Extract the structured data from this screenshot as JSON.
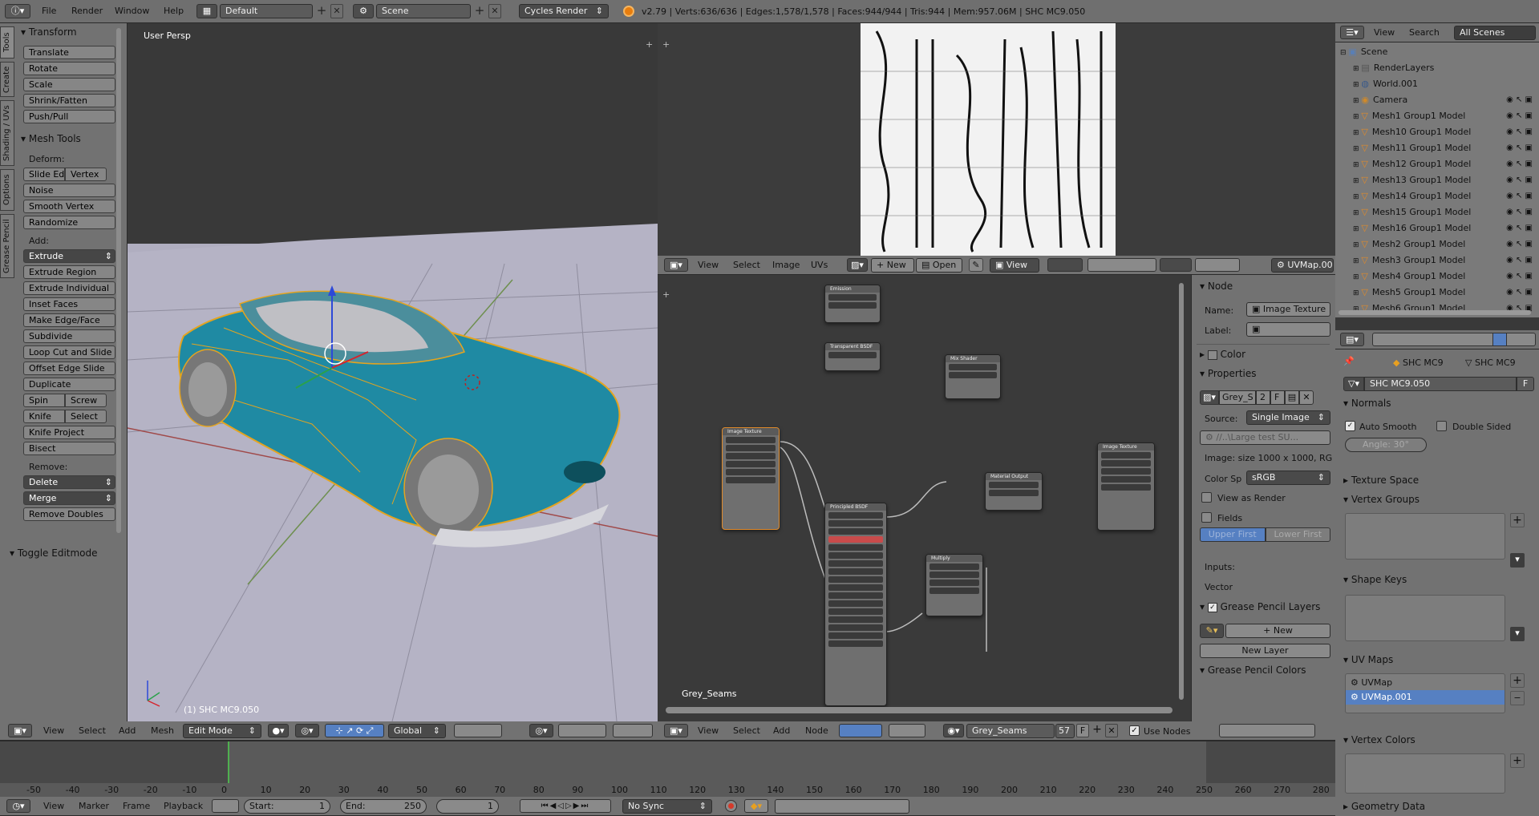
{
  "topbar": {
    "menus": [
      "File",
      "Render",
      "Window",
      "Help"
    ],
    "layout": "Default",
    "scene": "Scene",
    "engine": "Cycles Render",
    "stats": "v2.79 | Verts:636/636 | Edges:1,578/1,578 | Faces:944/944 | Tris:944 | Mem:957.06M | SHC MC9.050"
  },
  "toolshelf": {
    "tabs": [
      "Tools",
      "Create",
      "Shading / UVs",
      "Options",
      "Grease Pencil"
    ],
    "transform_title": "Transform",
    "transform": [
      "Translate",
      "Rotate",
      "Scale",
      "Shrink/Fatten",
      "Push/Pull"
    ],
    "mesh_tools_title": "Mesh Tools",
    "deform_label": "Deform:",
    "deform_pair": [
      "Slide Ed",
      "Vertex"
    ],
    "deform": [
      "Noise",
      "Smooth Vertex",
      "Randomize"
    ],
    "add_label": "Add:",
    "extrude": "Extrude",
    "add": [
      "Extrude Region",
      "Extrude Individual",
      "Inset Faces",
      "Make Edge/Face",
      "Subdivide",
      "Loop Cut and Slide",
      "Offset Edge Slide",
      "Duplicate"
    ],
    "spin_pair": [
      "Spin",
      "Screw"
    ],
    "knife_pair": [
      "Knife",
      "Select"
    ],
    "add2": [
      "Knife Project",
      "Bisect"
    ],
    "remove_label": "Remove:",
    "delete": "Delete",
    "merge": "Merge",
    "remove_doubles": "Remove Doubles",
    "toggle_editmode": "Toggle Editmode"
  },
  "viewport": {
    "view_name": "User Persp",
    "object_label": "(1) SHC MC9.050",
    "header": {
      "view": "View",
      "select": "Select",
      "add": "Add",
      "mesh": "Mesh",
      "mode": "Edit Mode",
      "orientation": "Global"
    }
  },
  "image_editor": {
    "header": {
      "view": "View",
      "select": "Select",
      "image": "Image",
      "uvs": "UVs",
      "new": "New",
      "open": "Open",
      "view2": "View",
      "uvmap": "UVMap.001"
    }
  },
  "node_editor": {
    "material_label": "Grey_Seams",
    "header": {
      "view": "View",
      "select": "Select",
      "add": "Add",
      "node": "Node",
      "material": "Grey_Seams",
      "users": "57",
      "fake": "F",
      "use_nodes": "Use Nodes"
    },
    "nodes": {
      "emission": "Emission",
      "transparent": "Transparent BSDF",
      "mix": "Mix Shader",
      "image_tex": "Image Texture",
      "principled": "Principled BSDF",
      "output": "Material Output",
      "math": "Multiply",
      "image_tex2": "Image Texture"
    }
  },
  "node_sidebar": {
    "node_section": "Node",
    "name_label": "Name:",
    "name_value": "Image Texture",
    "label_label": "Label:",
    "color_section": "Color",
    "properties_section": "Properties",
    "image_name": "Grey_S",
    "image_users": "2",
    "image_fake": "F",
    "source_label": "Source:",
    "source_value": "Single Image",
    "filepath": "//..\\Large test SU...",
    "image_info": "Image: size 1000 x 1000, RG",
    "colorspace_label": "Color Sp",
    "colorspace_value": "sRGB",
    "view_as_render": "View as Render",
    "fields": "Fields",
    "upper_first": "Upper First",
    "lower_first": "Lower First",
    "inputs_label": "Inputs:",
    "vector_label": "Vector",
    "gp_layers": "Grease Pencil Layers",
    "new_btn": "New",
    "new_layer": "New Layer",
    "gp_colors": "Grease Pencil Colors"
  },
  "outliner": {
    "header": {
      "view": "View",
      "search": "Search",
      "filter": "All Scenes"
    },
    "items": [
      {
        "label": "Scene",
        "indent": 0,
        "icon": "scene"
      },
      {
        "label": "RenderLayers",
        "indent": 1,
        "icon": "renderlayers"
      },
      {
        "label": "World.001",
        "indent": 1,
        "icon": "world"
      },
      {
        "label": "Camera",
        "indent": 1,
        "icon": "camera"
      },
      {
        "label": "Mesh1 Group1 Model",
        "indent": 1,
        "icon": "mesh"
      },
      {
        "label": "Mesh10 Group1 Model",
        "indent": 1,
        "icon": "mesh"
      },
      {
        "label": "Mesh11 Group1 Model",
        "indent": 1,
        "icon": "mesh"
      },
      {
        "label": "Mesh12 Group1 Model",
        "indent": 1,
        "icon": "mesh"
      },
      {
        "label": "Mesh13 Group1 Model",
        "indent": 1,
        "icon": "mesh"
      },
      {
        "label": "Mesh14 Group1 Model",
        "indent": 1,
        "icon": "mesh"
      },
      {
        "label": "Mesh15 Group1 Model",
        "indent": 1,
        "icon": "mesh"
      },
      {
        "label": "Mesh16 Group1 Model",
        "indent": 1,
        "icon": "mesh"
      },
      {
        "label": "Mesh2 Group1 Model",
        "indent": 1,
        "icon": "mesh"
      },
      {
        "label": "Mesh3 Group1 Model",
        "indent": 1,
        "icon": "mesh"
      },
      {
        "label": "Mesh4 Group1 Model",
        "indent": 1,
        "icon": "mesh"
      },
      {
        "label": "Mesh5 Group1 Model",
        "indent": 1,
        "icon": "mesh"
      },
      {
        "label": "Mesh6 Group1 Model",
        "indent": 1,
        "icon": "mesh"
      }
    ]
  },
  "properties": {
    "breadcrumb": [
      "SHC MC9",
      "SHC MC9"
    ],
    "mesh_name": "SHC MC9.050",
    "mesh_fake": "F",
    "normals": "Normals",
    "auto_smooth": "Auto Smooth",
    "double_sided": "Double Sided",
    "angle": "Angle:",
    "angle_value": "30°",
    "texture_space": "Texture Space",
    "vertex_groups": "Vertex Groups",
    "shape_keys": "Shape Keys",
    "uv_maps": "UV Maps",
    "uv_list": [
      "UVMap",
      "UVMap.001"
    ],
    "vertex_colors": "Vertex Colors",
    "geometry_data": "Geometry Data"
  },
  "timeline": {
    "ticks": [
      "-50",
      "-40",
      "-30",
      "-20",
      "-10",
      "0",
      "10",
      "20",
      "30",
      "40",
      "50",
      "60",
      "70",
      "80",
      "90",
      "100",
      "110",
      "120",
      "130",
      "140",
      "150",
      "160",
      "170",
      "180",
      "190",
      "200",
      "210",
      "220",
      "230",
      "240",
      "250",
      "260",
      "270",
      "280"
    ],
    "header": {
      "view": "View",
      "marker": "Marker",
      "frame": "Frame",
      "playback": "Playback",
      "start_label": "Start:",
      "start": "1",
      "end_label": "End:",
      "end": "250",
      "current": "1",
      "sync": "No Sync"
    }
  },
  "colors": {
    "car": "#1f8aa3",
    "wire": "#f0b020",
    "selected": "#5680c2"
  }
}
